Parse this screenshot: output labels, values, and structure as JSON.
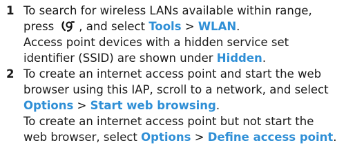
{
  "steps": [
    {
      "number": "1",
      "lines": {
        "l1": "To search for wireless LANs available within range,",
        "l2_a": "press",
        "l2_b": ", and select",
        "l2_tools": "Tools",
        "l2_sep": ">",
        "l2_wlan": "WLAN",
        "l2_end": ".",
        "l3": "Access point devices with a hidden service set",
        "l4_a": "identifier (SSID) are shown under",
        "l4_hidden": "Hidden",
        "l4_end": "."
      }
    },
    {
      "number": "2",
      "lines": {
        "l1": "To create an internet access point and start the web",
        "l2": "browser using this IAP, scroll to a network, and select",
        "l3_options": "Options",
        "l3_sep": ">",
        "l3_start": "Start web browsing",
        "l3_end": ".",
        "l4": "To create an internet access point but not start the",
        "l5_a": "web browser, select",
        "l5_options": "Options",
        "l5_sep": ">",
        "l5_define": "Define access point",
        "l5_end": "."
      }
    }
  ],
  "icons": {
    "menu_key": "menu-key-icon"
  },
  "colors": {
    "ui_text": "#2f8fd6",
    "body_text": "#1a1a1a"
  }
}
